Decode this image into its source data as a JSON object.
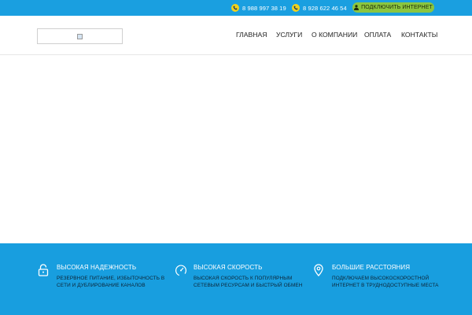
{
  "topbar": {
    "phones": [
      {
        "number": "8 988 997 38 19",
        "icon": "phone-icon"
      },
      {
        "number": "8 928 622 46 54",
        "icon": "phone-icon"
      }
    ],
    "connect_label": "ПОДКЛЮЧИТЬ ИНТЕРНЕТ",
    "connect_icon": "user-icon",
    "colors": {
      "bar": "#1a9fe0",
      "phone_icon_bg": "#f2d21b",
      "connect_bg": "#8cc63f"
    }
  },
  "header": {
    "logo_icon": "broken-image-icon",
    "nav": [
      "ГЛАВНАЯ",
      "УСЛУГИ",
      "О КОМПАНИИ",
      "ОПЛАТА",
      "КОНТАКТЫ"
    ]
  },
  "features": {
    "background": "#189edf",
    "items": [
      {
        "icon": "lock-icon",
        "title": "ВЫСОКАЯ НАДЕЖНОСТЬ",
        "description": "РЕЗЕРВНОЕ ПИТАНИЕ, ИЗБЫТОЧНОСТЬ В СЕТИ И ДУБЛИРОВАНИЕ КАНАЛОВ"
      },
      {
        "icon": "speedometer-icon",
        "title": "ВЫСОКАЯ СКОРОСТЬ",
        "description": "ВЫСОКАЯ СКОРОСТЬ К ПОПУЛЯРНЫМ СЕТЕВЫМ РЕСУРСАМ И БЫСТРЫЙ ОБМЕН"
      },
      {
        "icon": "map-pin-icon",
        "title": "БОЛЬШИЕ РАССТОЯНИЯ",
        "description": "ПОДКЛЮЧАЕМ ВЫСОКОСКОРОСТНОЙ ИНТЕРНЕТ В ТРУДНОДОСТУПНЫЕ МЕСТА"
      }
    ]
  }
}
